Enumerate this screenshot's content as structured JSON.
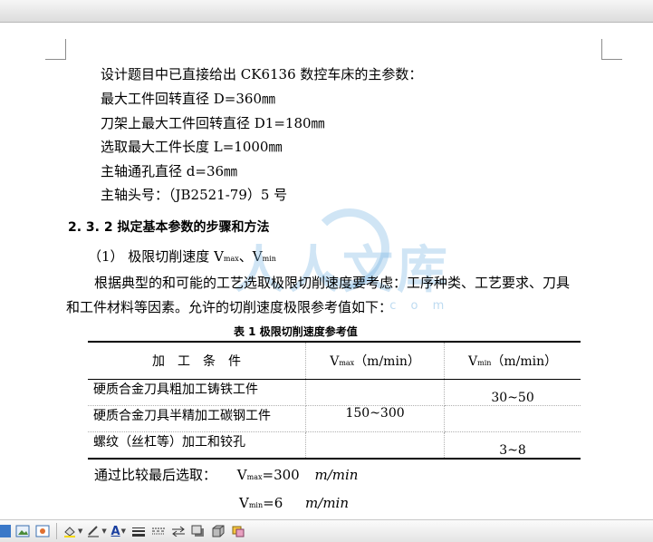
{
  "document": {
    "lines": [
      "设计题目中已直接给出 CK6136 数控车床的主参数：",
      "最大工件回转直径 D=360㎜",
      "刀架上最大工件回转直径 D1=180㎜",
      "选取最大工件长度 L=1000㎜",
      "主轴通孔直径 d=36㎜",
      "主轴头号：（JB2521-79）5 号"
    ],
    "heading": "2. 3. 2  拟定基本参数的步骤和方法",
    "item1": {
      "prefix": "（1）  极限切削速度  V",
      "sub1": "max",
      "mid": "、V",
      "sub2": "min"
    },
    "para1": "根据典型的和可能的工艺选取极限切削速度要考虑：工序种类、工艺要求、刀具",
    "para2": "和工件材料等因素。允许的切削速度极限参考值如下：",
    "caption": "表 1    极限切削速度参考值",
    "table": {
      "h1": "加　工　条　件",
      "h2_v": "V",
      "h2_sub": "max",
      "h2_unit": "（m/min）",
      "h3_v": "V",
      "h3_sub": "min",
      "h3_unit": "（m/min）",
      "rows": [
        {
          "cond": "硬质合金刀具粗加工铸铁工件",
          "vmax": "",
          "vmin": "30~50"
        },
        {
          "cond": "硬质合金刀具半精加工碳钢工件",
          "vmax": "150~300",
          "vmin": ""
        },
        {
          "cond": "螺纹（丝杠等）加工和铰孔",
          "vmax": "",
          "vmin": "3~8"
        }
      ]
    },
    "result_intro": "通过比较最后选取：",
    "result1": {
      "v": "V",
      "sub": "max",
      "val": "=300",
      "unit": "m/min"
    },
    "result2": {
      "v": "V",
      "sub": "min",
      "val": "=6",
      "unit": "m/min"
    }
  },
  "watermark": {
    "text": "人人文库",
    "com": ". c o m"
  },
  "toolbar": {
    "items": [
      "draw-select",
      "image",
      "shapes",
      "fill-color",
      "line-color",
      "font-color",
      "line-style",
      "dash-style",
      "arrow-style",
      "shadow",
      "3d",
      "misc"
    ],
    "font_color_glyph": "A"
  }
}
